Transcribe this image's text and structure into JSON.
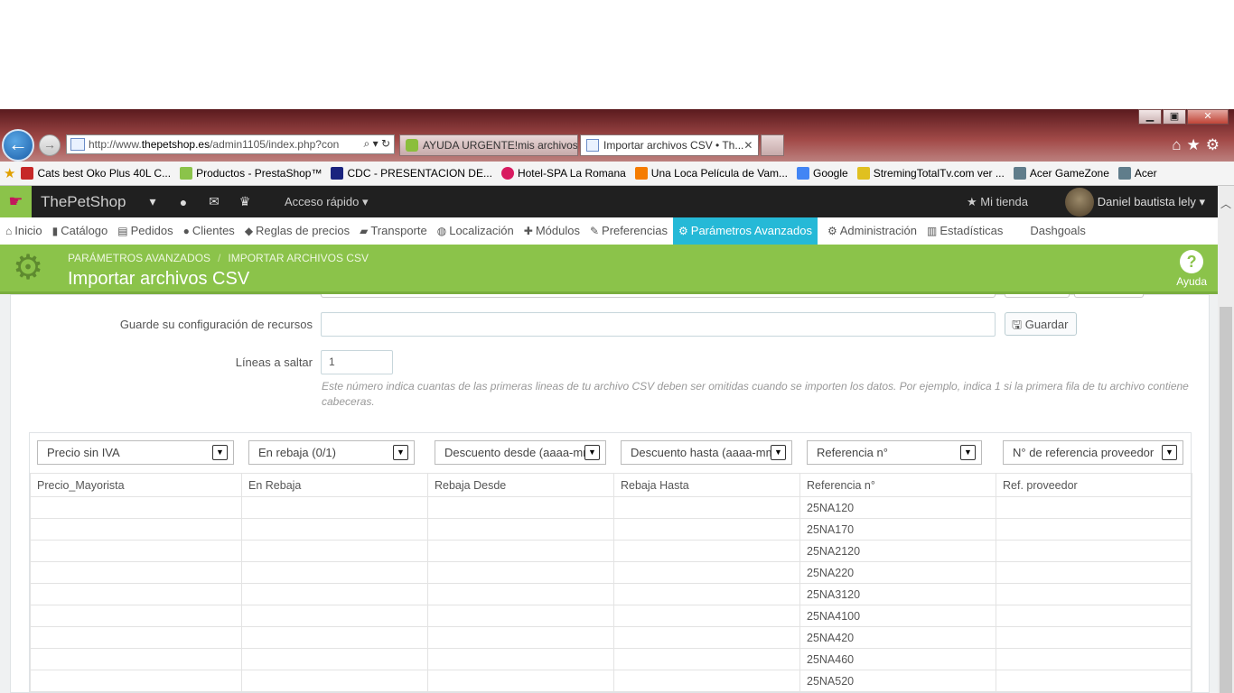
{
  "browser": {
    "url_prefix": "http://www.",
    "url_domain": "thepetshop.es",
    "url_path": "/admin1105/index.php?con",
    "url_controls": "⌕ ▾ ↻",
    "tabs": [
      {
        "title": "AYUDA URGENTE!mis archivos..."
      },
      {
        "title": "Importar archivos CSV • Th..."
      }
    ],
    "favorites": [
      {
        "label": "Cats best Oko Plus 40L  C...",
        "color": "#c62828"
      },
      {
        "label": "Productos - PrestaShop™",
        "color": "#8bc34a"
      },
      {
        "label": "CDC - PRESENTACION DE...",
        "color": "#1a237e"
      },
      {
        "label": "Hotel-SPA La Romana",
        "color": "#d81b60"
      },
      {
        "label": "Una Loca Película de Vam...",
        "color": "#f57c00"
      },
      {
        "label": "Google",
        "color": "#4285f4"
      },
      {
        "label": "StremingTotalTv.com ver ...",
        "color": "#1565c0"
      },
      {
        "label": "Acer GameZone",
        "color": "#607d8b"
      },
      {
        "label": "Acer",
        "color": "#607d8b"
      }
    ]
  },
  "header": {
    "brand": "ThePetShop",
    "quick_access": "Acceso rápido ▾",
    "my_store": "Mi tienda",
    "user": "Daniel bautista lely ▾"
  },
  "menu": [
    {
      "icon": "⌂",
      "label": "Inicio"
    },
    {
      "icon": "▮",
      "label": "Catálogo"
    },
    {
      "icon": "▤",
      "label": "Pedidos"
    },
    {
      "icon": "●",
      "label": "Clientes"
    },
    {
      "icon": "◆",
      "label": "Reglas de precios"
    },
    {
      "icon": "▰",
      "label": "Transporte"
    },
    {
      "icon": "◍",
      "label": "Localización"
    },
    {
      "icon": "✚",
      "label": "Módulos"
    },
    {
      "icon": "✎",
      "label": "Preferencias"
    },
    {
      "icon": "⚙",
      "label": "Parámetros Avanzados"
    },
    {
      "icon": "⚙",
      "label": "Administración"
    },
    {
      "icon": "▥",
      "label": "Estadísticas"
    },
    {
      "icon": "",
      "label": "Dashgoals"
    }
  ],
  "page": {
    "breadcrumb": [
      "PARÁMETROS AVANZADOS",
      "IMPORTAR ARCHIVOS CSV"
    ],
    "title": "Importar archivos CSV",
    "help": "Ayuda"
  },
  "form": {
    "save_config_label": "Guarde su configuración de recursos",
    "save_config_value": "",
    "save_button": "Guardar",
    "skip_label": "Líneas a saltar",
    "skip_value": "1",
    "hint": "Este número indica cuantas de las primeras lineas de tu archivo CSV deben ser omitidas cuando se importen los datos. Por ejemplo, indica 1 si la primera fila de tu archivo contiene cabeceras."
  },
  "mapping": {
    "selects": [
      "Precio sin IVA",
      "En rebaja (0/1)",
      "Descuento desde (aaaa-mm",
      "Descuento hasta (aaaa-mm",
      "Referencia n°",
      "N° de referencia proveedor"
    ],
    "columns": [
      "Precio_Mayorista",
      "En Rebaja",
      "Rebaja Desde",
      "Rebaja Hasta",
      "Referencia n°",
      "Ref. proveedor"
    ],
    "rows": [
      [
        "",
        "",
        "",
        "",
        "25NA120",
        ""
      ],
      [
        "",
        "",
        "",
        "",
        "25NA170",
        ""
      ],
      [
        "",
        "",
        "",
        "",
        "25NA2120",
        ""
      ],
      [
        "",
        "",
        "",
        "",
        "25NA220",
        ""
      ],
      [
        "",
        "",
        "",
        "",
        "25NA3120",
        ""
      ],
      [
        "",
        "",
        "",
        "",
        "25NA4100",
        ""
      ],
      [
        "",
        "",
        "",
        "",
        "25NA420",
        ""
      ],
      [
        "",
        "",
        "",
        "",
        "25NA460",
        ""
      ],
      [
        "",
        "",
        "",
        "",
        "25NA520",
        ""
      ]
    ]
  }
}
